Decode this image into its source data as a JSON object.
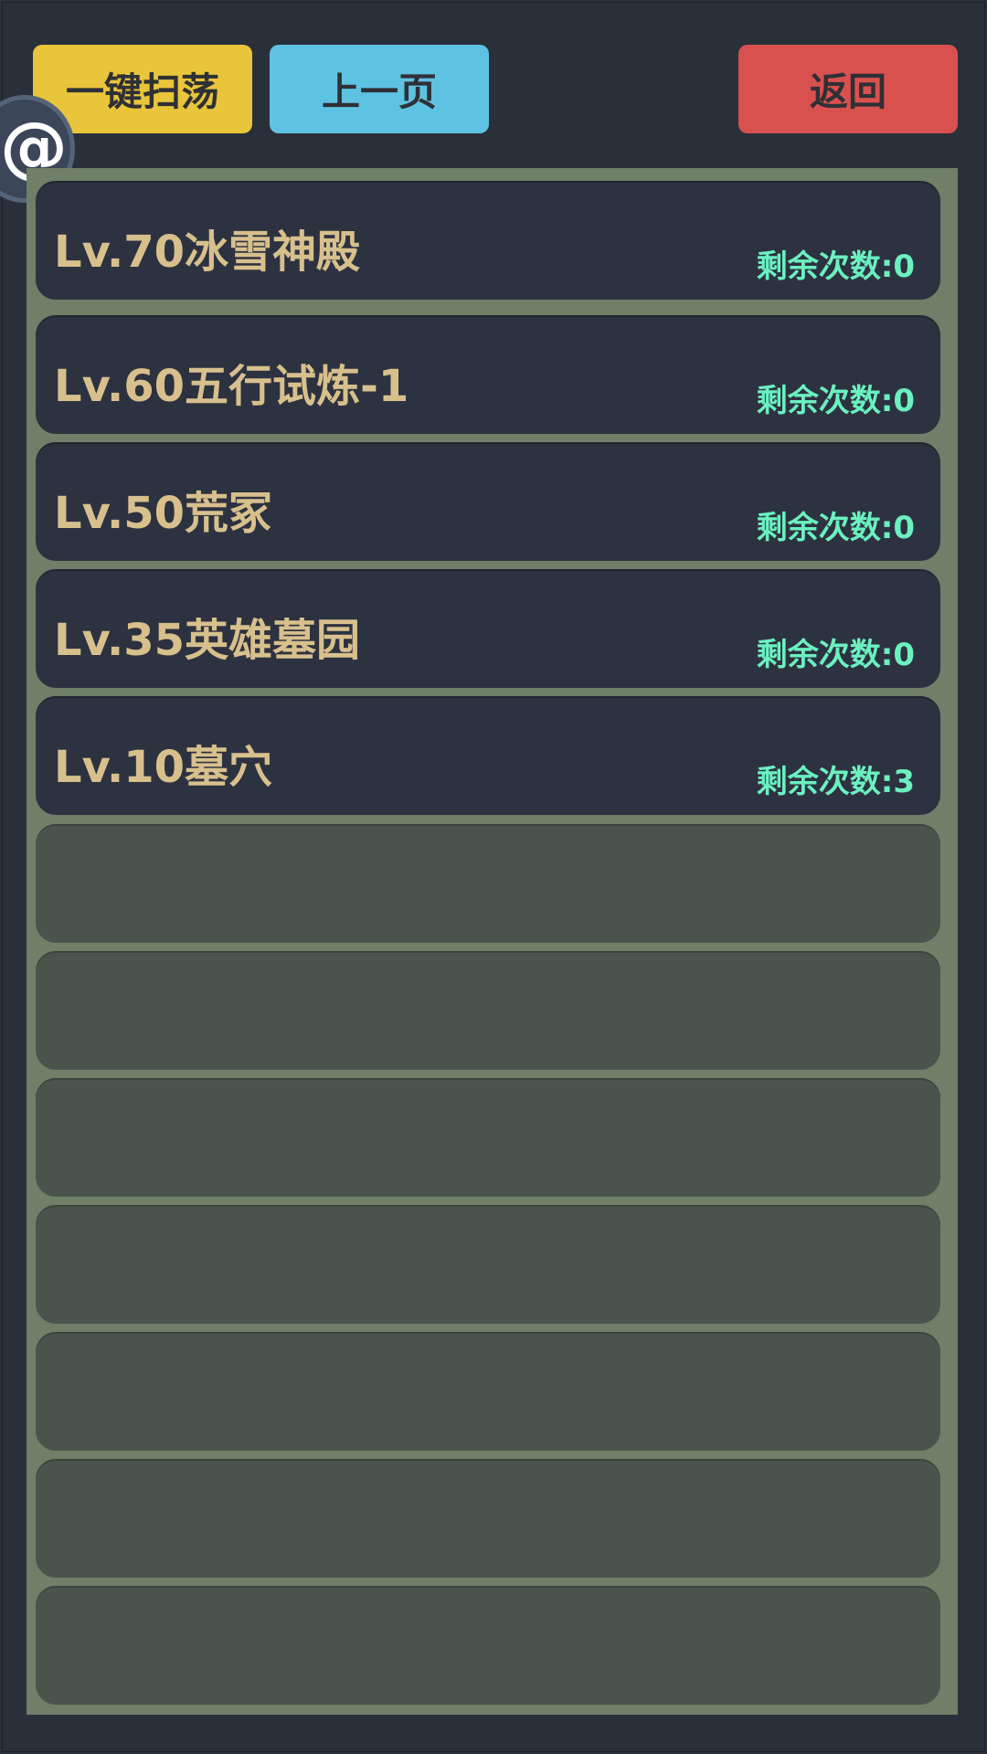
{
  "toolbar": {
    "sweep_label": "一键扫荡",
    "prev_label": "上一页",
    "back_label": "返回"
  },
  "float_badge": {
    "glyph": "@",
    "icon": "at-sign-icon"
  },
  "dungeons": [
    {
      "name": "Lv.70冰雪神殿",
      "remaining": "剩余次数:0"
    },
    {
      "name": "Lv.60五行试炼-1",
      "remaining": "剩余次数:0"
    },
    {
      "name": "Lv.50荒冢",
      "remaining": "剩余次数:0"
    },
    {
      "name": "Lv.35英雄墓园",
      "remaining": "剩余次数:0"
    },
    {
      "name": "Lv.10墓穴",
      "remaining": "剩余次数:3"
    }
  ],
  "colors": {
    "background": "#2a303a",
    "panel": "#6f7f68",
    "slot_filled": "#2d3240",
    "slot_empty": "#4a544c",
    "name_text": "#d8c08d",
    "remaining_text": "#6bf0c0",
    "sweep_button": "#e8c53a",
    "prev_button": "#5ec3e2",
    "back_button": "#d9514f"
  }
}
